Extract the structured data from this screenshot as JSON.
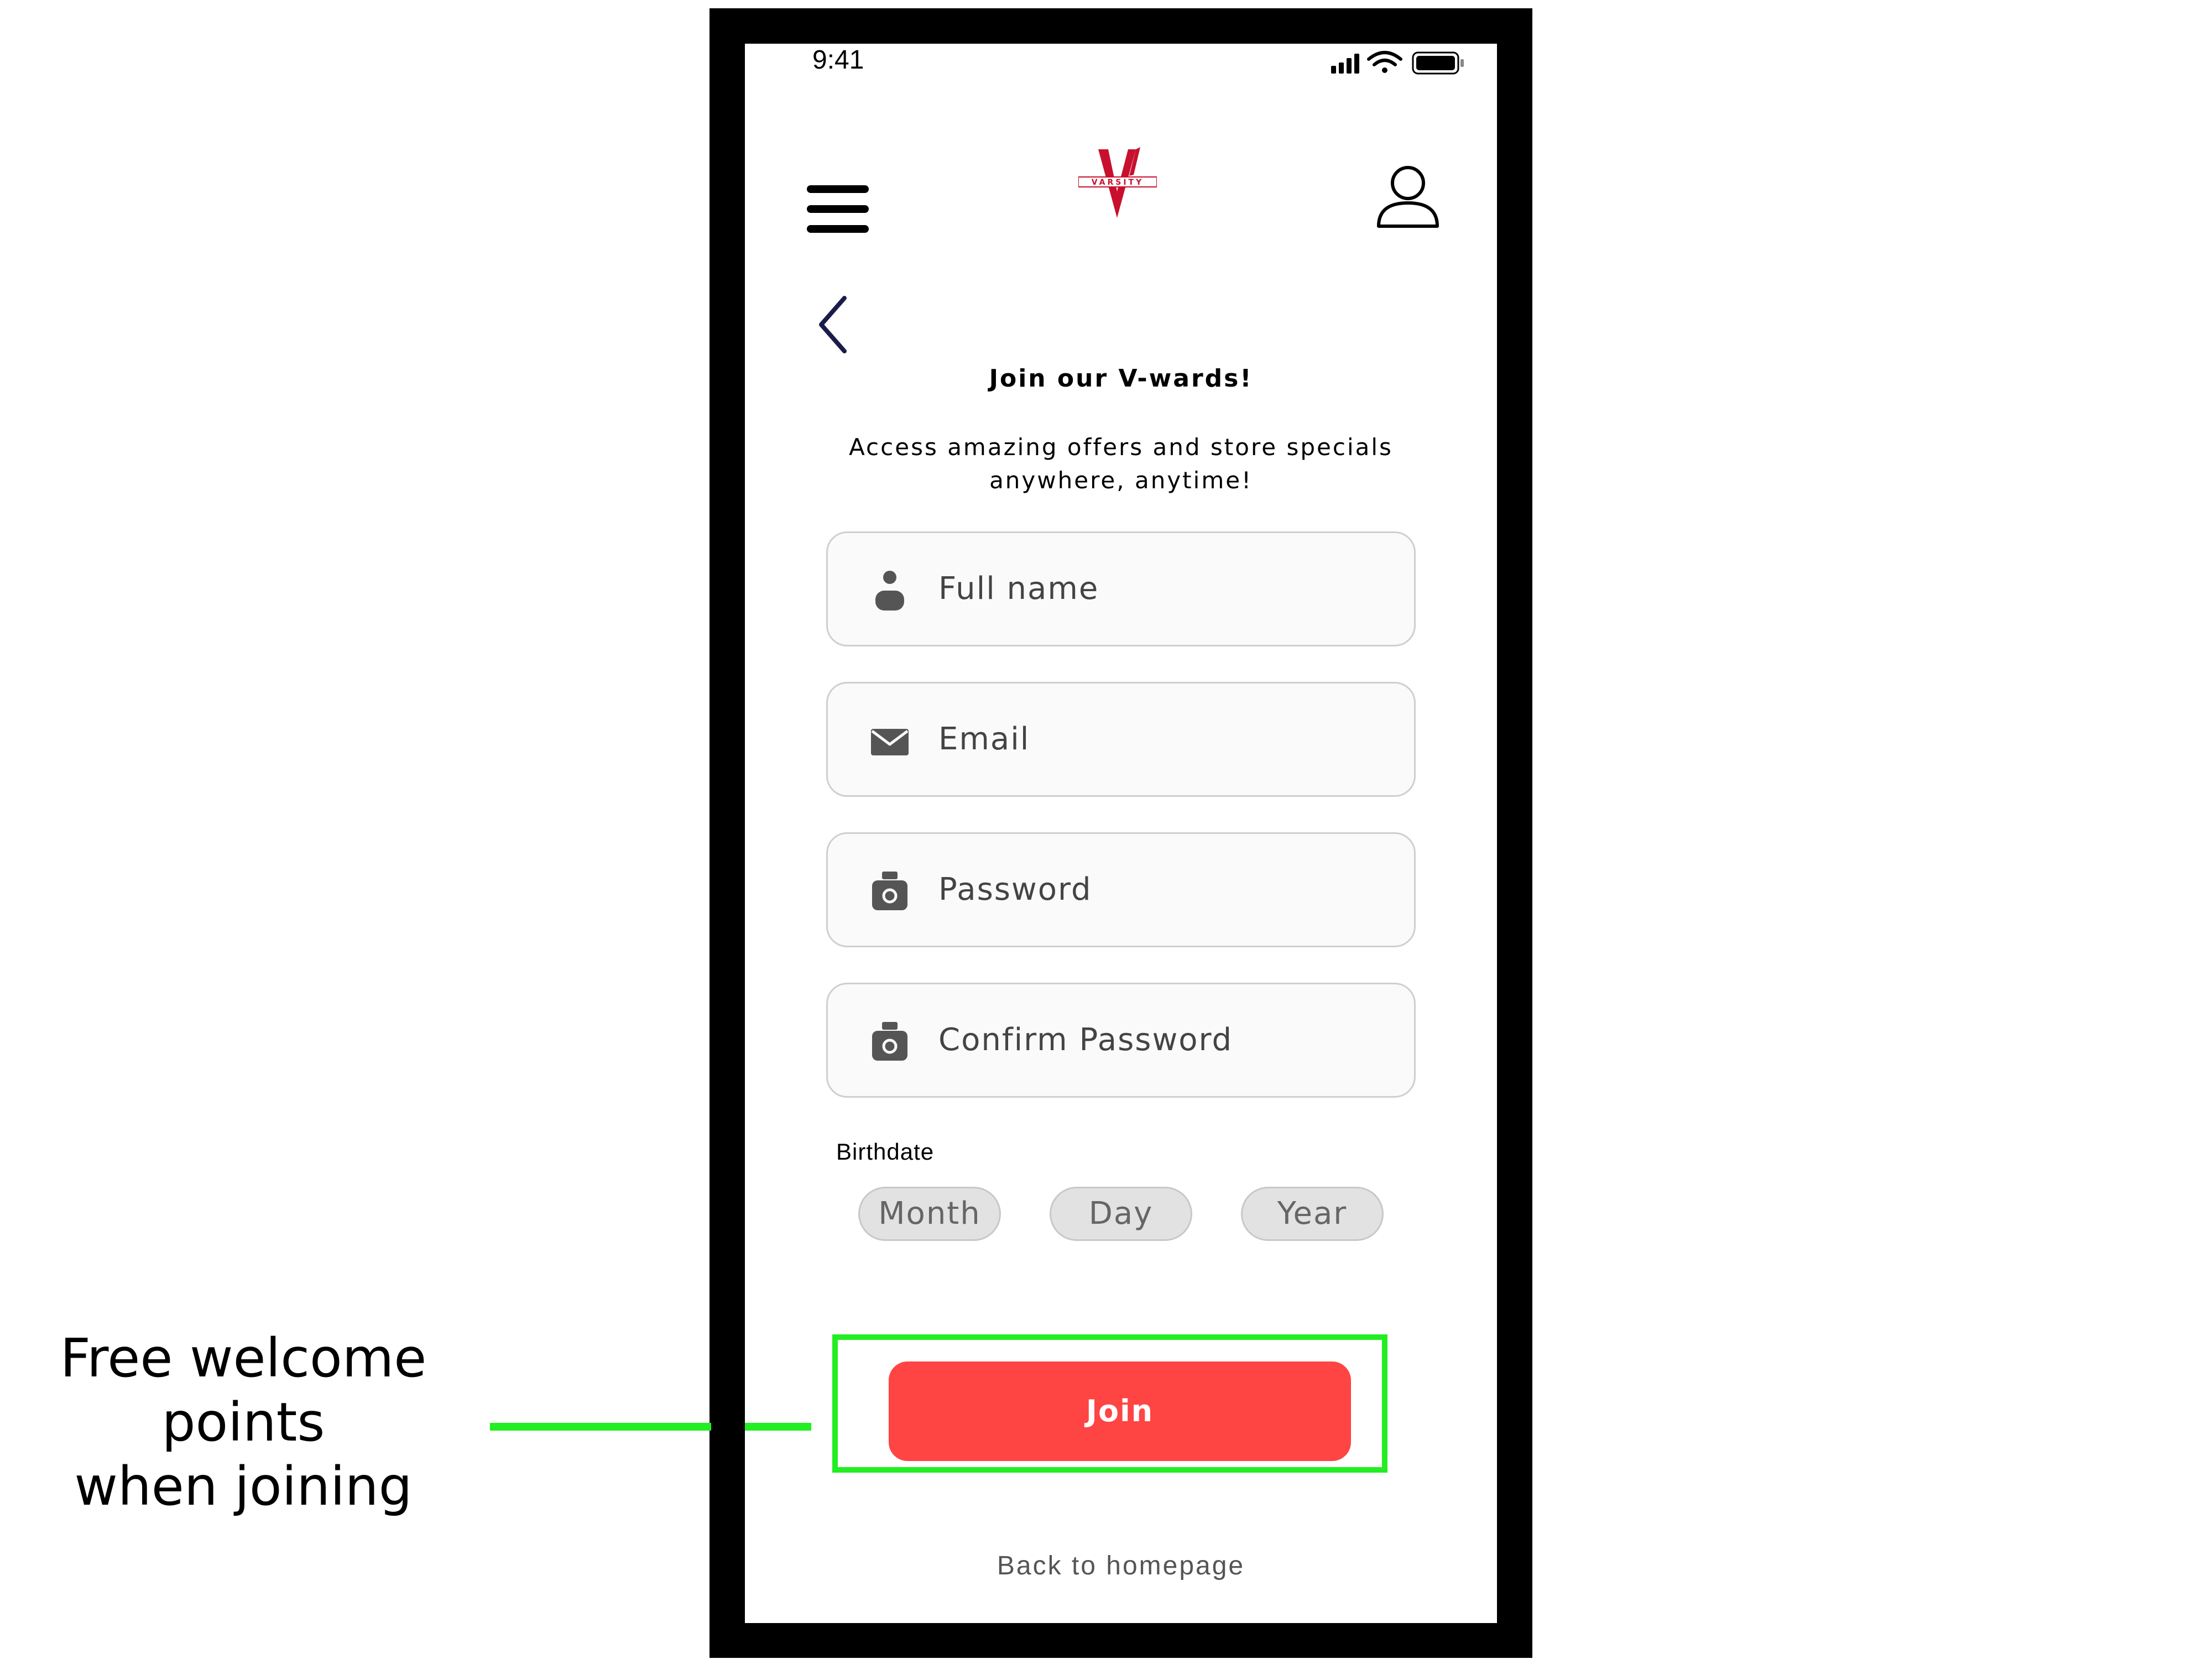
{
  "status_bar": {
    "time": "9:41"
  },
  "header": {
    "logo_text": "VARSITY",
    "brand_color": "#c8102e"
  },
  "form": {
    "title": "Join our V-wards!",
    "subtitle_line1": "Access amazing offers and store specials",
    "subtitle_line2": "anywhere, anytime!",
    "fields": [
      {
        "icon": "person-icon",
        "placeholder": "Full name"
      },
      {
        "icon": "mail-icon",
        "placeholder": "Email"
      },
      {
        "icon": "lock-icon",
        "placeholder": "Password"
      },
      {
        "icon": "lock-icon",
        "placeholder": "Confirm Password"
      }
    ],
    "birthdate_label": "Birthdate",
    "birthdate_options": [
      "Month",
      "Day",
      "Year"
    ],
    "join_label": "Join",
    "join_color": "#ff4444",
    "back_link": "Back to homepage"
  },
  "annotation": {
    "line1": "Free welcome points",
    "line2": "when joining",
    "color": "#22ee22"
  }
}
